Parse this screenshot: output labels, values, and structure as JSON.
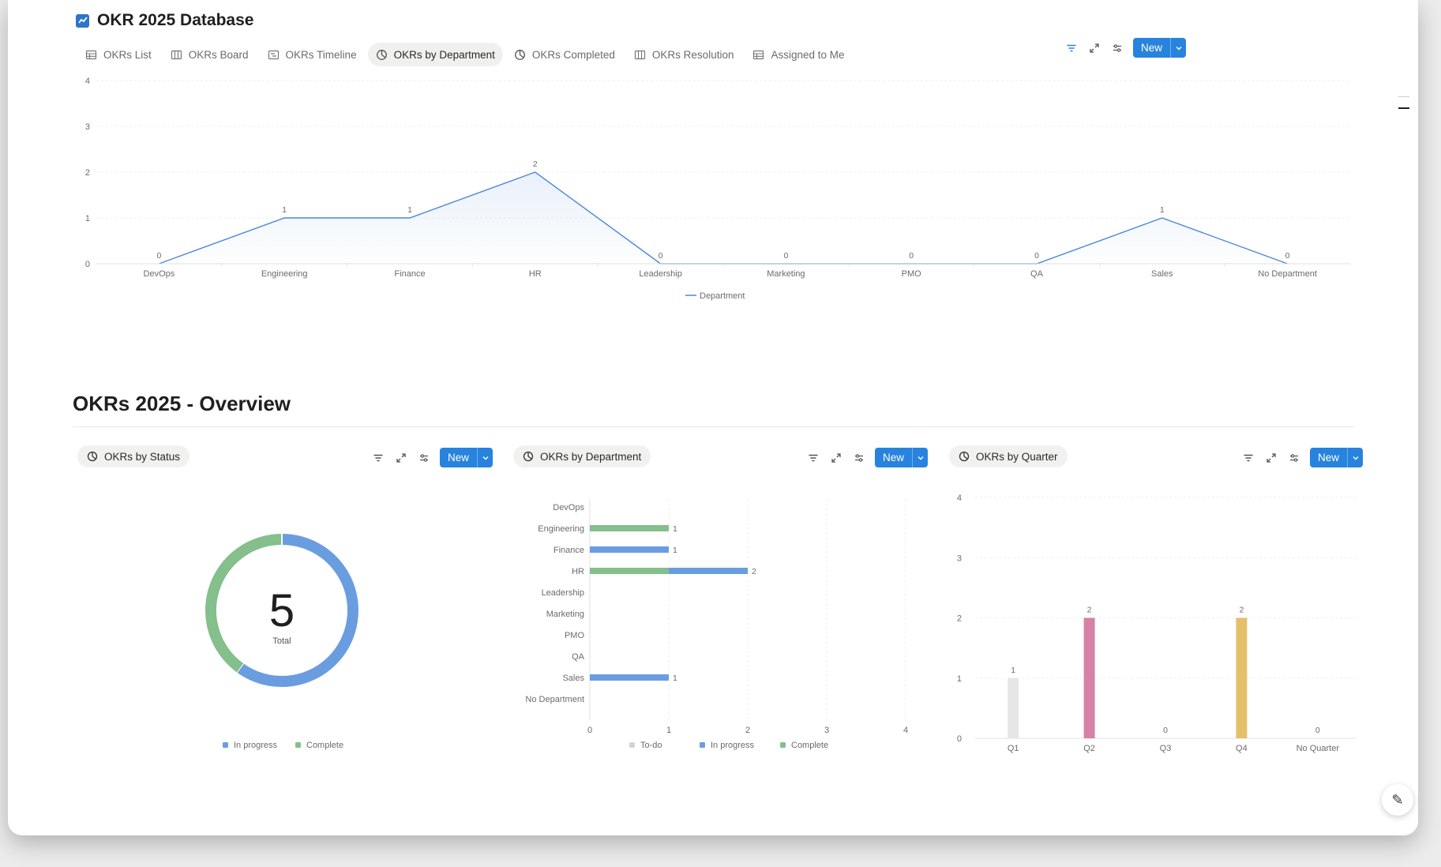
{
  "title": "OKR 2025 Database",
  "tabs": [
    {
      "label": "OKRs List",
      "icon": "table-icon"
    },
    {
      "label": "OKRs Board",
      "icon": "board-icon"
    },
    {
      "label": "OKRs Timeline",
      "icon": "timeline-icon"
    },
    {
      "label": "OKRs by Department",
      "icon": "chart-icon"
    },
    {
      "label": "OKRs Completed",
      "icon": "chart-icon"
    },
    {
      "label": "OKRs Resolution",
      "icon": "board-icon"
    },
    {
      "label": "Assigned to Me",
      "icon": "table-icon"
    }
  ],
  "active_tab": 3,
  "new_label": "New",
  "overview_title": "OKRs 2025 - Overview",
  "widgets": {
    "status": {
      "label": "OKRs by Status"
    },
    "department": {
      "label": "OKRs by Department"
    },
    "quarter": {
      "label": "OKRs by Quarter"
    }
  },
  "colors": {
    "accent": "#2783de",
    "blue": "#6a9de0",
    "green": "#84bf8c",
    "grey": "#d4d4d4",
    "pink": "#d682a6",
    "yellow": "#e6bf6c",
    "line": "#4b88d8"
  },
  "chart_data": [
    {
      "type": "line",
      "categories": [
        "DevOps",
        "Engineering",
        "Finance",
        "HR",
        "Leadership",
        "Marketing",
        "PMO",
        "QA",
        "Sales",
        "No Department"
      ],
      "series": [
        {
          "name": "Department",
          "values": [
            0,
            1,
            1,
            2,
            0,
            0,
            0,
            0,
            1,
            0
          ]
        }
      ],
      "ylim": [
        0,
        4
      ],
      "yticks": [
        0,
        1,
        2,
        3,
        4
      ],
      "legend": "bottom-center"
    },
    {
      "type": "pie",
      "categories": [
        "In progress",
        "Complete"
      ],
      "values": [
        3,
        2
      ],
      "center_value": "5",
      "center_label": "Total",
      "legend": "bottom-center"
    },
    {
      "type": "bar",
      "orientation": "horizontal",
      "categories": [
        "DevOps",
        "Engineering",
        "Finance",
        "HR",
        "Leadership",
        "Marketing",
        "PMO",
        "QA",
        "Sales",
        "No Department"
      ],
      "series": [
        {
          "name": "To-do",
          "values": [
            0,
            0,
            0,
            0,
            0,
            0,
            0,
            0,
            0,
            0
          ]
        },
        {
          "name": "In progress",
          "values": [
            0,
            0,
            1,
            1,
            0,
            0,
            0,
            0,
            1,
            0
          ]
        },
        {
          "name": "Complete",
          "values": [
            0,
            1,
            0,
            1,
            0,
            0,
            0,
            0,
            0,
            0
          ]
        }
      ],
      "totals": [
        null,
        1,
        1,
        2,
        null,
        null,
        null,
        null,
        1,
        null
      ],
      "xlim": [
        0,
        4
      ],
      "xticks": [
        0,
        1,
        2,
        3,
        4
      ],
      "legend": "bottom-center"
    },
    {
      "type": "bar",
      "categories": [
        "Q1",
        "Q2",
        "Q3",
        "Q4",
        "No Quarter"
      ],
      "values": [
        1,
        2,
        0,
        2,
        0
      ],
      "ylim": [
        0,
        4
      ],
      "yticks": [
        0,
        1,
        2,
        3,
        4
      ]
    }
  ]
}
